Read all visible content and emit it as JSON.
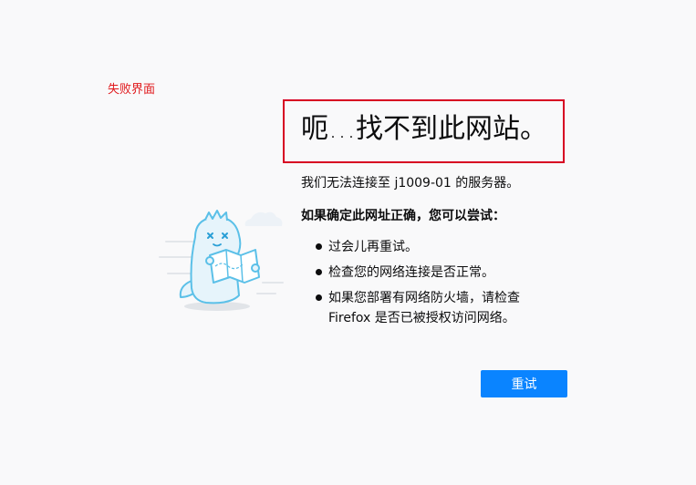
{
  "annotation": {
    "label": "失败界面"
  },
  "error_page": {
    "title": "呃…找不到此网站。",
    "description": "我们无法连接至 j1009-01 的服务器。",
    "suggest_heading": "如果确定此网址正确，您可以尝试：",
    "suggestions": [
      "过会儿再重试。",
      "检查您的网络连接是否正常。",
      "如果您部署有网络防火墙，请检查 Firefox 是否已被授权访问网络。"
    ],
    "retry_label": "重试",
    "illustration_icon": "dinosaur-holding-map-icon"
  },
  "colors": {
    "accent": "#0a84ff",
    "highlight": "#d70022",
    "annotation_text": "#e0181b",
    "background": "#f9f9fa"
  }
}
